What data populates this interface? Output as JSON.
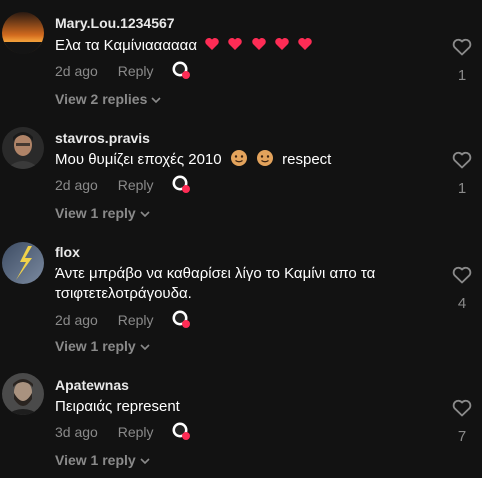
{
  "comments": [
    {
      "username": "Mary.Lou.1234567",
      "text": "Ελα τα Καμίνιαααααα",
      "emoji_hearts": 5,
      "age": "2d ago",
      "reply_label": "Reply",
      "view_replies": "View 2 replies",
      "likes": "1",
      "avatar": "sunset-avatar"
    },
    {
      "username": "stavros.pravis",
      "text_before": "Μου θυμίζει εποχές 2010",
      "text_after": "respect",
      "age": "2d ago",
      "reply_label": "Reply",
      "view_replies": "View 1 reply",
      "likes": "1",
      "avatar": "man-avatar"
    },
    {
      "username": "flox",
      "text": "Άντε μπράβο να καθαρίσει λίγο το Καμίνι απο τα τσιφτετελοτράγουδα.",
      "age": "2d ago",
      "reply_label": "Reply",
      "view_replies": "View 1 reply",
      "likes": "4",
      "avatar": "lightning-avatar"
    },
    {
      "username": "Apatewnas",
      "text": "Πειραιάς represent",
      "age": "3d ago",
      "reply_label": "Reply",
      "view_replies": "View 1 reply",
      "likes": "7",
      "avatar": "bearded-man-avatar"
    }
  ],
  "colors": {
    "background": "#121212",
    "muted": "#8a8a8a",
    "heart_emoji": "#fe2c55"
  }
}
